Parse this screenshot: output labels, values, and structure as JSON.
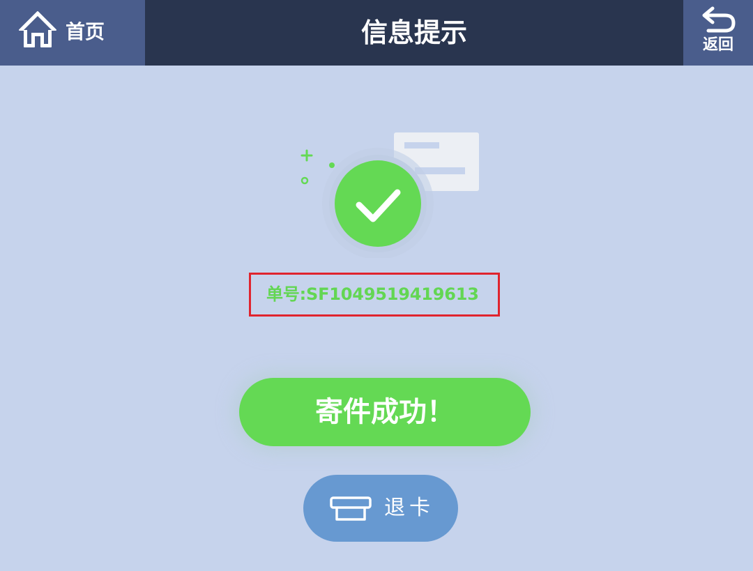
{
  "header": {
    "home_label": "首页",
    "title": "信息提示",
    "back_label": "返回"
  },
  "result": {
    "order_number": "单号:SF1049519419613"
  },
  "actions": {
    "success_label": "寄件成功！",
    "eject_card_label": "退卡"
  },
  "colors": {
    "header_bg": "#29354f",
    "nav_button_bg": "#4a5d8c",
    "page_bg": "#c6d3ec",
    "success_green": "#64d954",
    "card_button_blue": "#6799d1",
    "highlight_red": "#e0242e"
  },
  "icons": {
    "home": "home-icon",
    "back": "undo-arrow-icon",
    "check": "check-icon",
    "card": "card-slot-icon"
  }
}
